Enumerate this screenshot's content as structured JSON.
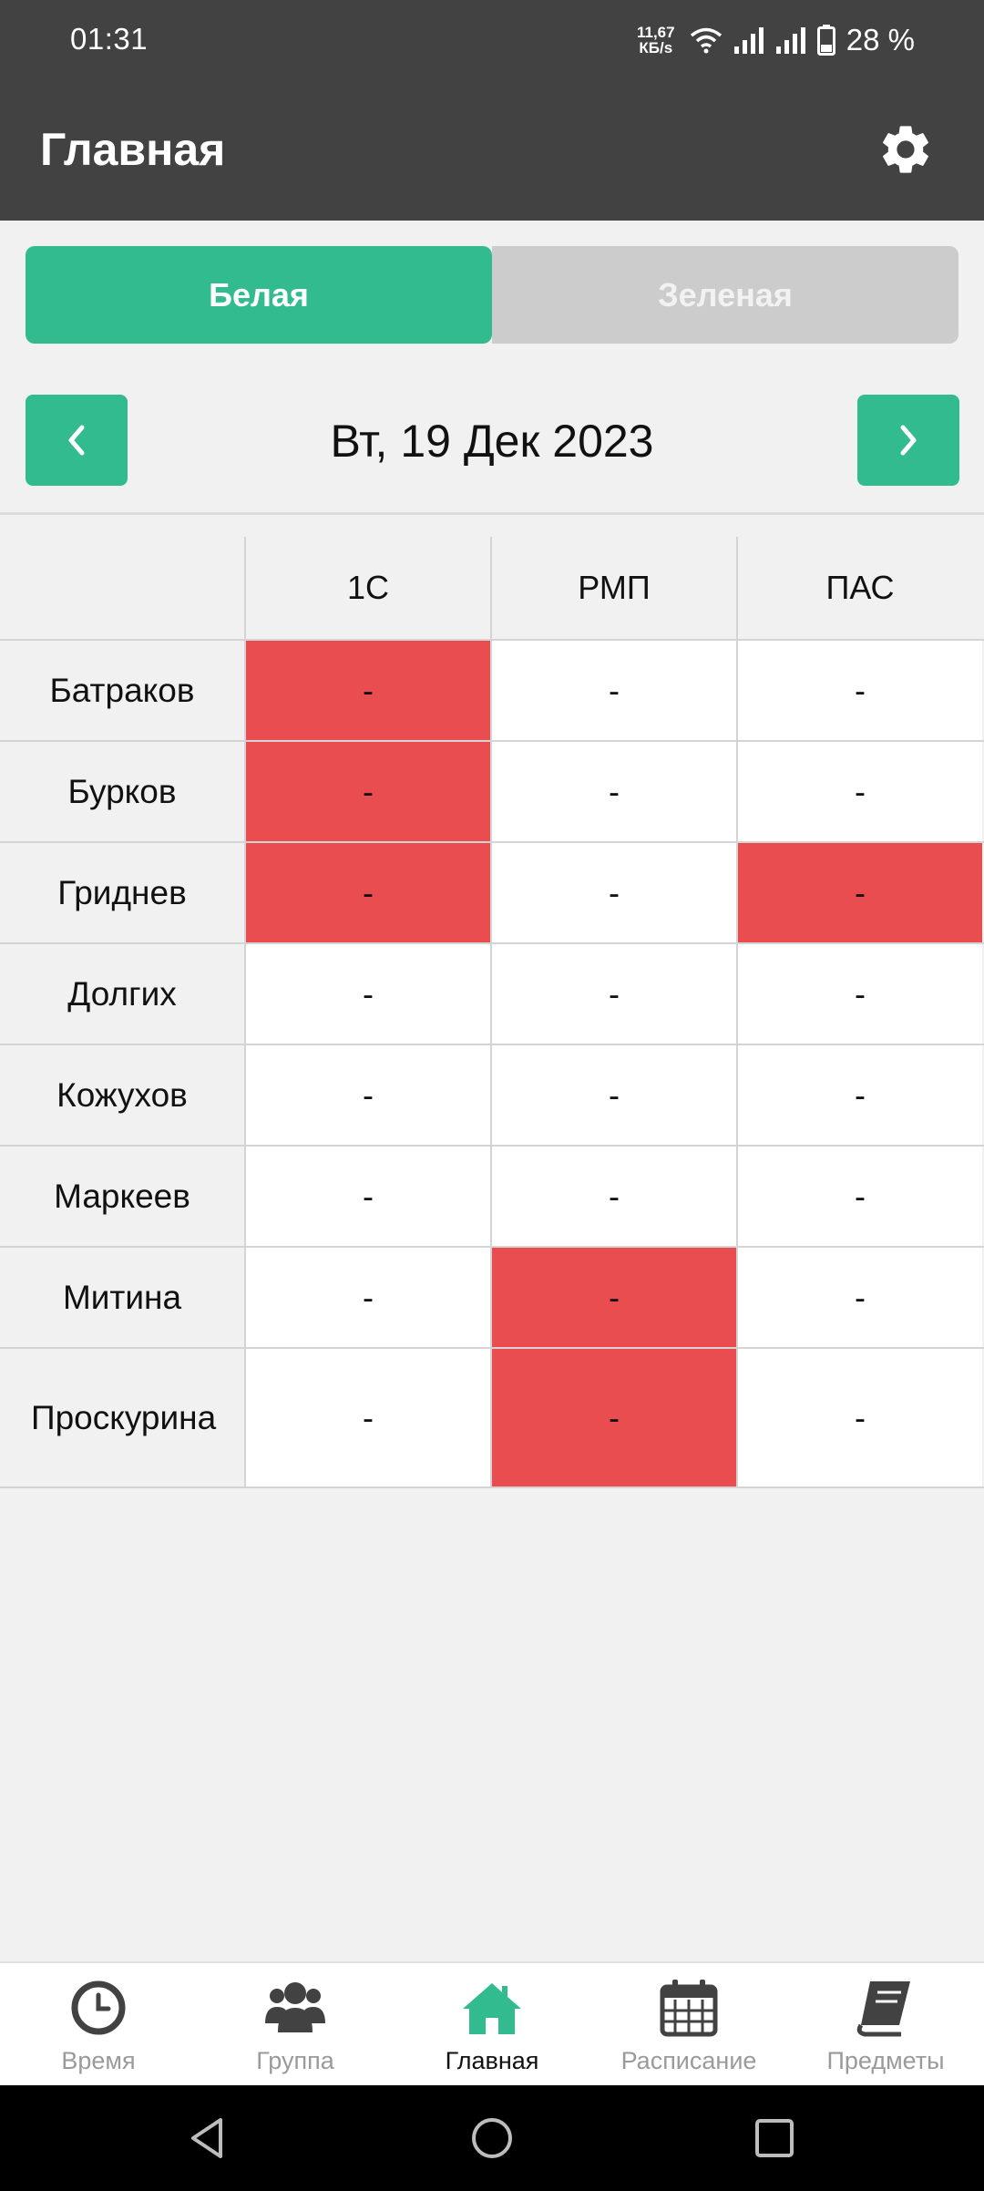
{
  "status_bar": {
    "time": "01:31",
    "speed_value": "11,67",
    "speed_unit": "КБ/s",
    "battery": "28 %"
  },
  "app_bar": {
    "title": "Главная",
    "settings_icon": "gear-icon"
  },
  "segments": {
    "active": "Белая",
    "inactive": "Зеленая"
  },
  "date_nav": {
    "date": "Вт, 19 Дек 2023",
    "prev_icon": "chevron-left-icon",
    "next_icon": "chevron-right-icon"
  },
  "table": {
    "columns": [
      "1С",
      "РМП",
      "ПАС"
    ],
    "rows": [
      {
        "name": "Батраков",
        "cells": [
          "-",
          "-",
          "-"
        ],
        "highlight": [
          true,
          false,
          false
        ]
      },
      {
        "name": "Бурков",
        "cells": [
          "-",
          "-",
          "-"
        ],
        "highlight": [
          true,
          false,
          false
        ]
      },
      {
        "name": "Гриднев",
        "cells": [
          "-",
          "-",
          "-"
        ],
        "highlight": [
          true,
          false,
          true
        ]
      },
      {
        "name": "Долгих",
        "cells": [
          "-",
          "-",
          "-"
        ],
        "highlight": [
          false,
          false,
          false
        ]
      },
      {
        "name": "Кожухов",
        "cells": [
          "-",
          "-",
          "-"
        ],
        "highlight": [
          false,
          false,
          false
        ]
      },
      {
        "name": "Маркеев",
        "cells": [
          "-",
          "-",
          "-"
        ],
        "highlight": [
          false,
          false,
          false
        ]
      },
      {
        "name": "Митина",
        "cells": [
          "-",
          "-",
          "-"
        ],
        "highlight": [
          false,
          true,
          false
        ]
      },
      {
        "name": "Проскурина",
        "cells": [
          "-",
          "-",
          "-"
        ],
        "highlight": [
          false,
          true,
          false
        ]
      }
    ],
    "highlight_color": "#ea4d4f"
  },
  "bottom_nav": {
    "items": [
      {
        "label": "Время",
        "icon": "clock-icon"
      },
      {
        "label": "Группа",
        "icon": "users-icon"
      },
      {
        "label": "Главная",
        "icon": "home-icon"
      },
      {
        "label": "Расписание",
        "icon": "calendar-icon"
      },
      {
        "label": "Предметы",
        "icon": "book-icon"
      }
    ],
    "active_index": 2
  },
  "colors": {
    "accent": "#31bb8f",
    "header": "#424242",
    "inactive_segment": "#cccccc"
  }
}
